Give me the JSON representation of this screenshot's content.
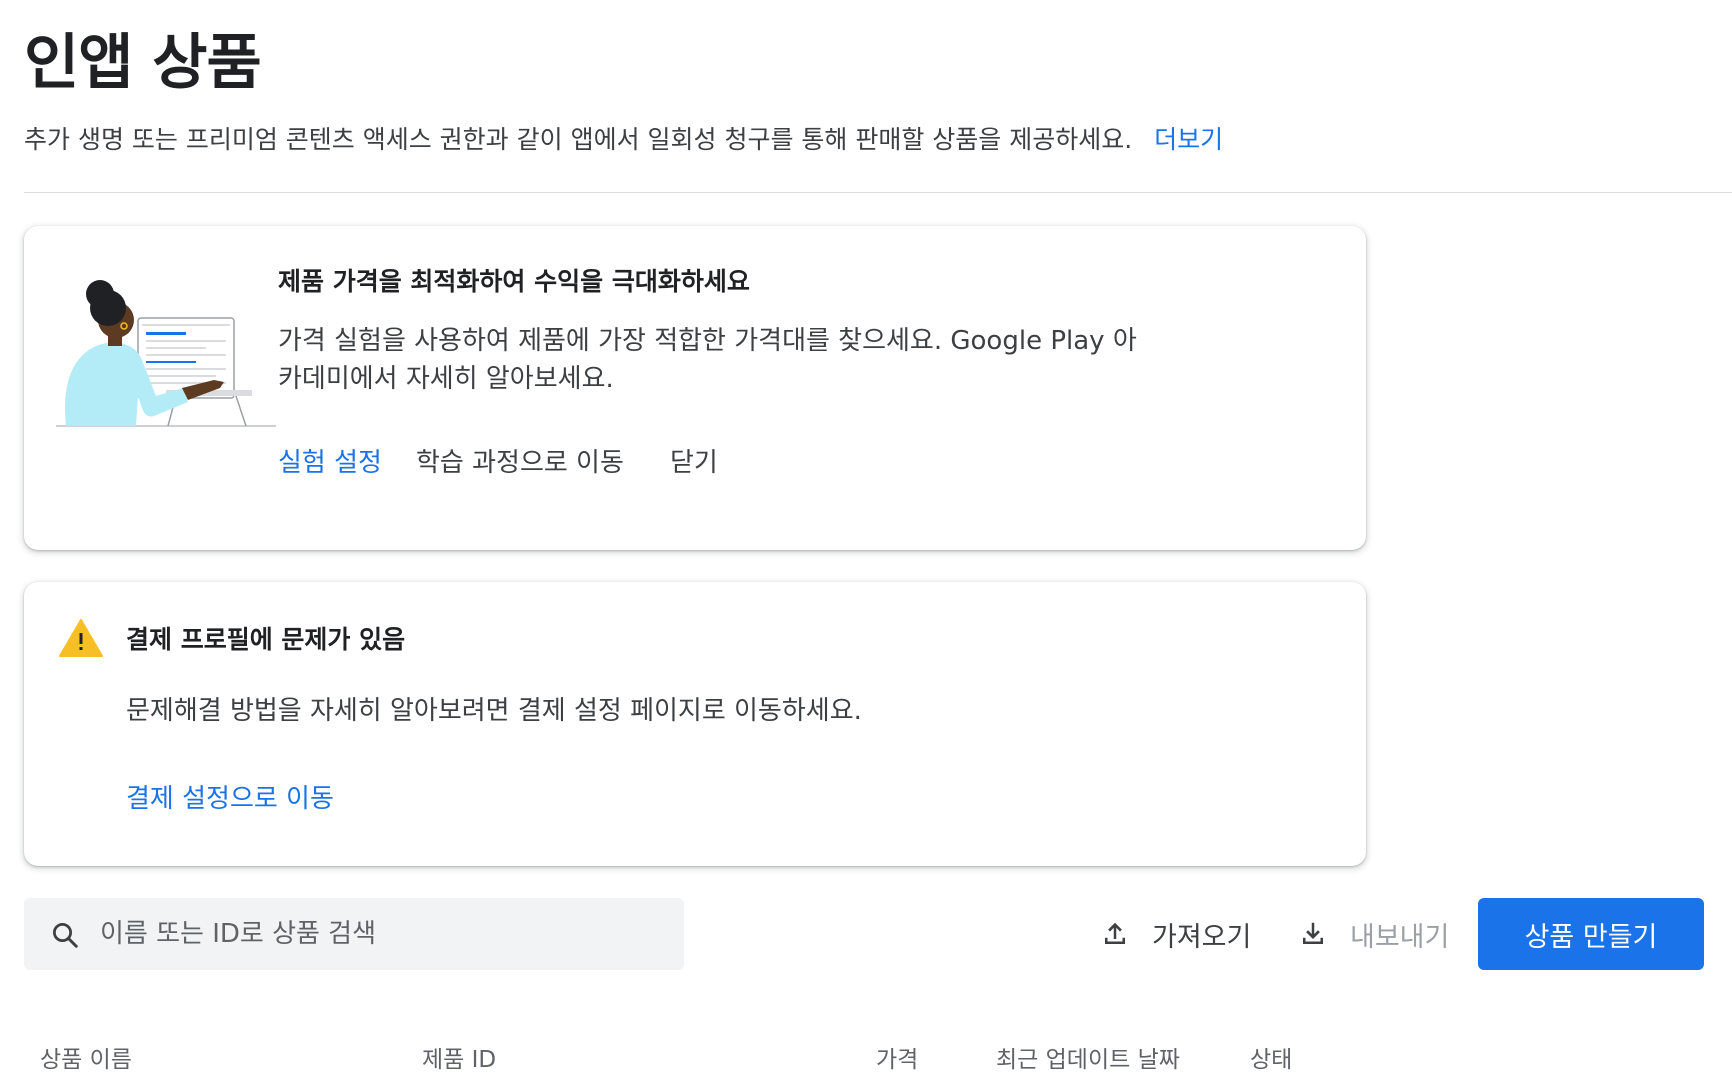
{
  "page": {
    "title": "인앱 상품",
    "description": "추가 생명 또는 프리미엄 콘텐츠 액세스 권한과 같이 앱에서 일회성 청구를 통해 판매할 상품을 제공하세요.",
    "more_link": "더보기"
  },
  "pricing_card": {
    "title": "제품 가격을 최적화하여 수익을 극대화하세요",
    "body": "가격 실험을 사용하여 제품에 가장 적합한 가격대를 찾으세요. Google Play 아카데미에서 자세히 알아보세요.",
    "actions": {
      "setup": "실험 설정",
      "course": "학습 과정으로 이동",
      "close": "닫기"
    }
  },
  "payment_card": {
    "title": "결제 프로필에 문제가 있음",
    "body": "문제해결 방법을 자세히 알아보려면 결제 설정 페이지로 이동하세요.",
    "action": "결제 설정으로 이동"
  },
  "toolbar": {
    "search_placeholder": "이름 또는 ID로 상품 검색",
    "search_value": "",
    "import_label": "가져오기",
    "export_label": "내보내기",
    "create_label": "상품 만들기"
  },
  "table": {
    "columns": [
      "상품 이름",
      "제품 ID",
      "가격",
      "최근 업데이트 날짜",
      "상태"
    ]
  },
  "colors": {
    "accent": "#1a73e8",
    "warning": "#f6bf26",
    "illustration_shirt": "#b3ecf7",
    "text_primary": "#202124",
    "text_secondary": "#3c4043",
    "disabled": "#9aa0a6"
  }
}
